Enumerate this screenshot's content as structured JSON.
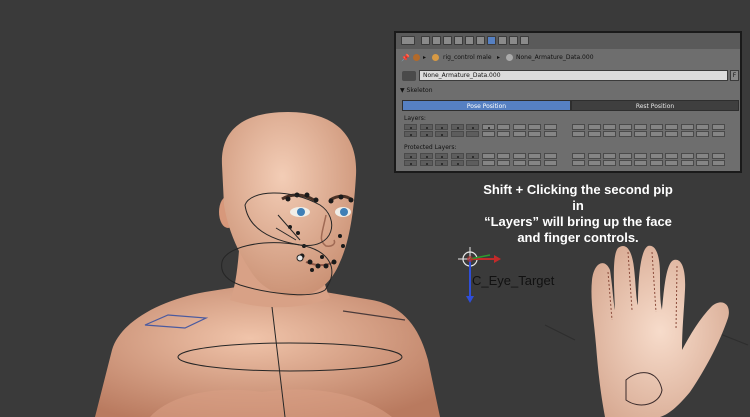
{
  "panel": {
    "breadcrumb": {
      "object_name": "rig_control male",
      "data_name": "None_Armature_Data.000"
    },
    "datablock": {
      "name": "None_Armature_Data.000",
      "fake_user": "F"
    },
    "section_title": "Skeleton",
    "pose_position_label": "Pose Position",
    "rest_position_label": "Rest Position",
    "layers_label": "Layers:",
    "protected_layers_label": "Protected Layers:"
  },
  "viewport": {
    "object_label": "C_Eye_Target",
    "annotation_lines": [
      "Shift + Clicking the second pip in",
      "“Layers” will bring up the face",
      "and finger controls."
    ]
  },
  "colors": {
    "viewport_bg": "#3a3a3a",
    "panel_bg": "#6e6e6e",
    "accent_blue": "#5680c2",
    "skin": "#e7b79d"
  }
}
